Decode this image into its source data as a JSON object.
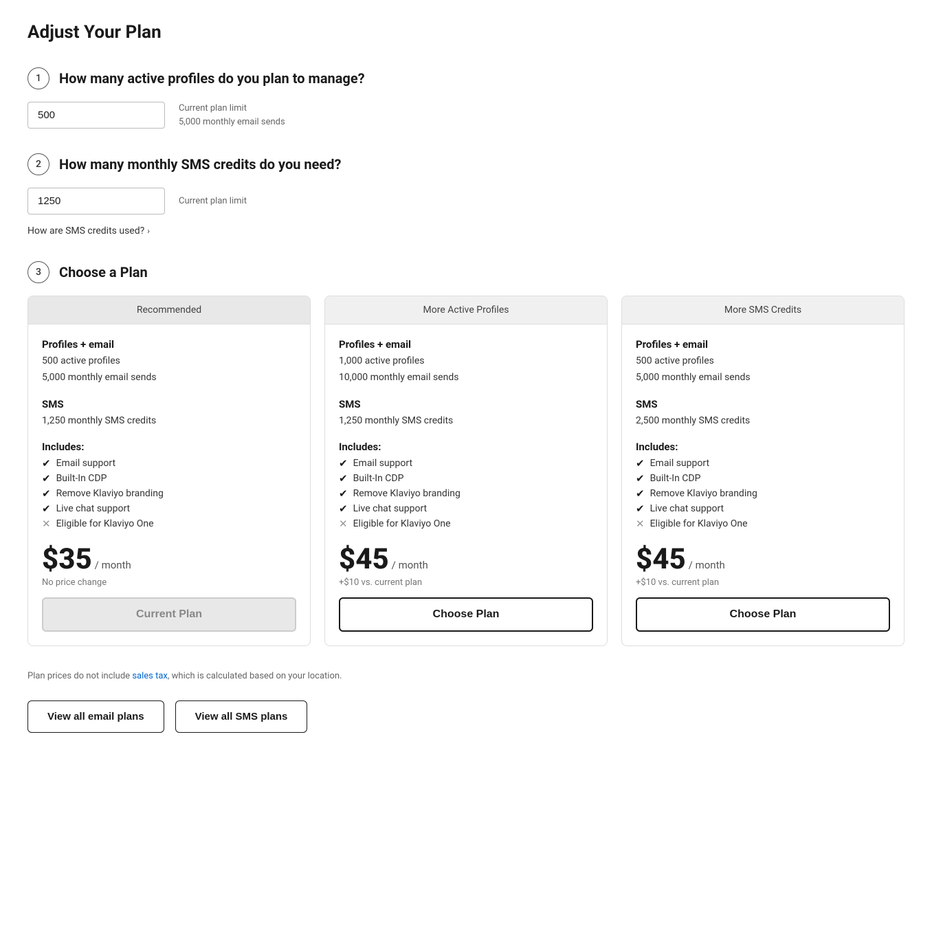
{
  "page": {
    "title": "Adjust Your Plan"
  },
  "step1": {
    "number": "1",
    "question": "How many active profiles do you plan to manage?",
    "input_value": "500",
    "hint_line1": "Current plan limit",
    "hint_line2": "5,000 monthly email sends"
  },
  "step2": {
    "number": "2",
    "question": "How many monthly SMS credits do you need?",
    "input_value": "1250",
    "hint": "Current plan limit",
    "sms_link": "How are SMS credits used?",
    "sms_link_chevron": "›"
  },
  "step3": {
    "number": "3",
    "question": "Choose a Plan"
  },
  "plans": [
    {
      "header": "Recommended",
      "header_type": "recommended",
      "email_label": "Profiles + email",
      "email_profiles": "500 active profiles",
      "email_sends": "5,000 monthly email sends",
      "sms_label": "SMS",
      "sms_credits": "1,250 monthly SMS credits",
      "includes_label": "Includes:",
      "features": [
        {
          "icon": "check",
          "text": "Email support"
        },
        {
          "icon": "check",
          "text": "Built-In CDP"
        },
        {
          "icon": "check",
          "text": "Remove Klaviyo branding"
        },
        {
          "icon": "check",
          "text": "Live chat support"
        },
        {
          "icon": "x",
          "text": "Eligible for Klaviyo One"
        }
      ],
      "price": "$35",
      "period": "/ month",
      "price_note": "No price change",
      "button_label": "Current Plan",
      "button_type": "current"
    },
    {
      "header": "More Active Profiles",
      "header_type": "normal",
      "email_label": "Profiles + email",
      "email_profiles": "1,000 active profiles",
      "email_sends": "10,000 monthly email sends",
      "sms_label": "SMS",
      "sms_credits": "1,250 monthly SMS credits",
      "includes_label": "Includes:",
      "features": [
        {
          "icon": "check",
          "text": "Email support"
        },
        {
          "icon": "check",
          "text": "Built-In CDP"
        },
        {
          "icon": "check",
          "text": "Remove Klaviyo branding"
        },
        {
          "icon": "check",
          "text": "Live chat support"
        },
        {
          "icon": "x",
          "text": "Eligible for Klaviyo One"
        }
      ],
      "price": "$45",
      "period": "/ month",
      "price_note": "+$10 vs. current plan",
      "button_label": "Choose Plan",
      "button_type": "choose"
    },
    {
      "header": "More SMS Credits",
      "header_type": "normal",
      "email_label": "Profiles + email",
      "email_profiles": "500 active profiles",
      "email_sends": "5,000 monthly email sends",
      "sms_label": "SMS",
      "sms_credits": "2,500 monthly SMS credits",
      "includes_label": "Includes:",
      "features": [
        {
          "icon": "check",
          "text": "Email support"
        },
        {
          "icon": "check",
          "text": "Built-In CDP"
        },
        {
          "icon": "check",
          "text": "Remove Klaviyo branding"
        },
        {
          "icon": "check",
          "text": "Live chat support"
        },
        {
          "icon": "x",
          "text": "Eligible for Klaviyo One"
        }
      ],
      "price": "$45",
      "period": "/ month",
      "price_note": "+$10 vs. current plan",
      "button_label": "Choose Plan",
      "button_type": "choose"
    }
  ],
  "tax_note_prefix": "Plan prices do not include ",
  "tax_link": "sales tax",
  "tax_note_suffix": ", which is calculated based on your location.",
  "bottom_buttons": [
    {
      "label": "View all email plans"
    },
    {
      "label": "View all SMS plans"
    }
  ]
}
